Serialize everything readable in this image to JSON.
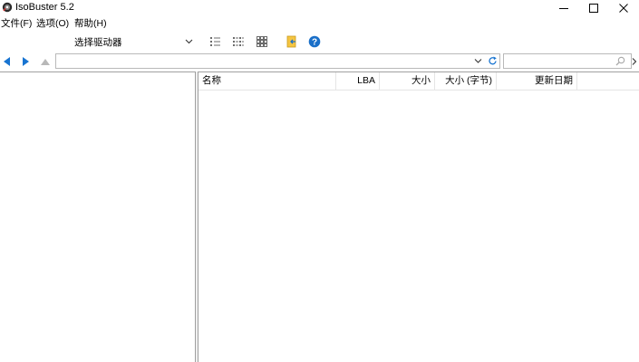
{
  "window": {
    "title": "IsoBuster 5.2",
    "controls": {
      "minimize": "minimize",
      "maximize": "maximize",
      "close": "close"
    }
  },
  "menu": {
    "items": [
      {
        "label": "文件(F)"
      },
      {
        "label": "选项(O)"
      },
      {
        "label": "帮助(H)"
      }
    ]
  },
  "toolbar": {
    "drive_select": {
      "label": "选择驱动器"
    },
    "icons": [
      "details-view-icon",
      "list-view-icon",
      "large-icons-view-icon",
      "extract-folder-icon",
      "help-icon"
    ]
  },
  "navigation": {
    "back": "back-arrow-icon",
    "forward": "forward-arrow-icon",
    "up": "up-arrow-icon",
    "path_value": "",
    "search_value": ""
  },
  "list": {
    "columns": [
      {
        "label": "名称",
        "align": "left"
      },
      {
        "label": "LBA",
        "align": "right"
      },
      {
        "label": "大小",
        "align": "right"
      },
      {
        "label": "大小 (字节)",
        "align": "right"
      },
      {
        "label": "更新日期",
        "align": "right"
      }
    ],
    "rows": []
  },
  "colors": {
    "accent": "#1874d1",
    "help": "#1a6fc8",
    "folder": "#f5c542"
  }
}
